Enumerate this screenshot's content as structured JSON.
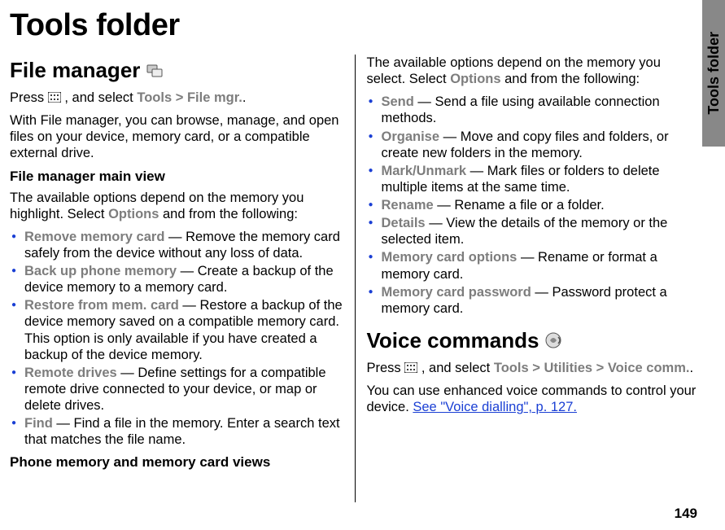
{
  "side_tab": "Tools folder",
  "page_number": "149",
  "title": "Tools folder",
  "file_manager": {
    "heading": "File manager",
    "press_line": {
      "pre": "Press ",
      "post": ", and select ",
      "path1": "Tools",
      "gt": ">",
      "path2": "File mgr.",
      "end": "."
    },
    "intro": "With File manager, you can browse, manage, and open files on your device, memory card, or a compatible external drive.",
    "main_view_heading": "File manager main view",
    "main_view_intro_a": "The available options depend on the memory you highlight. Select ",
    "main_view_intro_b": "Options",
    "main_view_intro_c": " and from the following:",
    "opts1": [
      {
        "term": "Remove memory card",
        "desc": " — Remove the memory card safely from the device without any loss of data."
      },
      {
        "term": "Back up phone memory",
        "desc": " — Create a backup of the device memory to a memory card."
      },
      {
        "term": "Restore from mem. card",
        "desc": " — Restore a backup of the device memory saved on a compatible memory card. This option is only available if you have created a backup of the device memory."
      },
      {
        "term": "Remote drives",
        "desc": " — Define settings for a compatible remote drive connected to your device, or map or delete drives."
      },
      {
        "term": "Find",
        "desc": " — Find a file in the memory. Enter a search text that matches the file name."
      }
    ],
    "phone_mem_heading": "Phone memory and memory card views",
    "phone_mem_intro_a": "The available options depend on the memory you select. Select ",
    "phone_mem_intro_b": "Options",
    "phone_mem_intro_c": " and from the following:",
    "opts2": [
      {
        "term": "Send",
        "desc": " — Send a file using available connection methods."
      },
      {
        "term": "Organise",
        "desc": " — Move and copy files and folders, or create new folders in the memory."
      },
      {
        "term": "Mark/Unmark",
        "desc": " — Mark files or folders to delete multiple items at the same time."
      },
      {
        "term": "Rename",
        "desc": " — Rename a file or a folder."
      },
      {
        "term": "Details",
        "desc": " — View the details of the memory or the selected item."
      },
      {
        "term": "Memory card options",
        "desc": " — Rename or format a memory card."
      },
      {
        "term": "Memory card password",
        "desc": " — Password protect a memory card."
      }
    ]
  },
  "voice_commands": {
    "heading": "Voice commands",
    "press_line": {
      "pre": "Press ",
      "post": ", and select ",
      "p1": "Tools",
      "gt": ">",
      "p2": "Utilities",
      "p3": "Voice comm.",
      "end": "."
    },
    "body_a": "You can use enhanced voice commands to control your device. ",
    "link": "See \"Voice dialling\", p. 127."
  }
}
